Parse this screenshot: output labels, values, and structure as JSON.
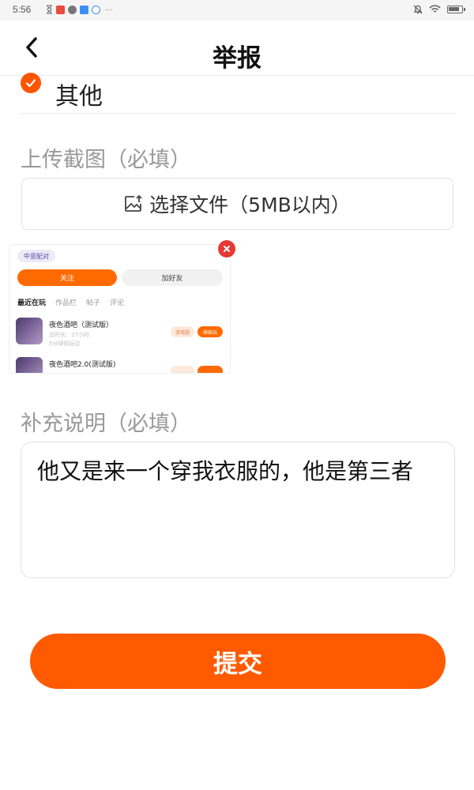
{
  "status_bar": {
    "time": "5:56",
    "more": "···",
    "icons_left": [
      "hourglass-icon",
      "red-app-icon",
      "wechat-icon",
      "blue-app-icon",
      "browser-icon"
    ],
    "icons_right": [
      "mute-icon",
      "wifi-icon",
      "battery-icon"
    ]
  },
  "header": {
    "title": "举报",
    "back_icon": "chevron-left-icon"
  },
  "selected_option": {
    "label": "其他",
    "checked": true
  },
  "screenshot_section": {
    "label": "上传截图（必填）",
    "upload_label": "选择文件（5MB以内）",
    "upload_icon": "image-upload-icon"
  },
  "thumbnail": {
    "pill": "中意配对",
    "follow_label": "关注",
    "friend_label": "加好友",
    "tabs": [
      "最近在玩",
      "作品栏",
      "帖子",
      "评论"
    ],
    "items": [
      {
        "name": "夜色酒吧（测试版）",
        "meta1": "总时长：27小时",
        "meta2": "5分钟前玩过",
        "tag1": "游戏圈",
        "tag2": "继续玩"
      },
      {
        "name": "夜色酒吧2.0(测试版)",
        "meta1": "",
        "meta2": "",
        "tag1": "",
        "tag2": ""
      }
    ]
  },
  "description_section": {
    "label": "补充说明（必填）",
    "text": "他又是来一个穿我衣服的，他是第三者"
  },
  "submit": {
    "label": "提交"
  },
  "colors": {
    "accent": "#ff5a00",
    "remove": "#e53935"
  }
}
